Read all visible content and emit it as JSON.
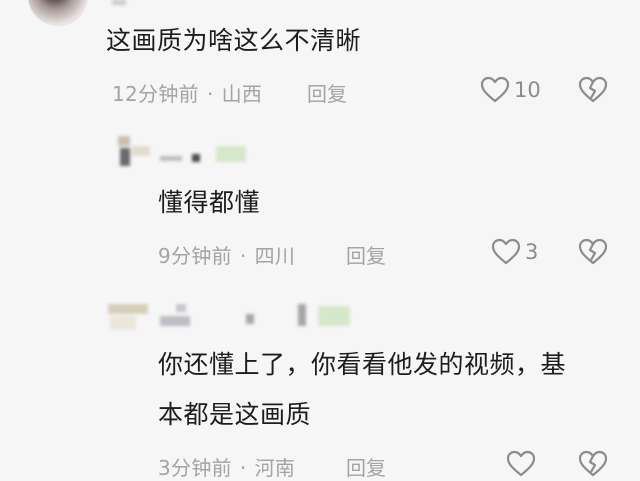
{
  "comments": [
    {
      "text": "这画质为啥这么不清晰",
      "time": "12分钟前",
      "location": "山西",
      "reply_label": "回复",
      "likes": "10"
    },
    {
      "text": "懂得都懂",
      "time": "9分钟前",
      "location": "四川",
      "reply_label": "回复",
      "likes": "3"
    },
    {
      "text_line1": "你还懂上了，你看看他发的视频，基",
      "text_line2": "本都是这画质",
      "time": "3分钟前",
      "location": "河南",
      "reply_label": "回复"
    }
  ],
  "meta_separator": "·",
  "colors": {
    "background": "#f6f6f7",
    "text": "#1d1d1d",
    "meta": "#a3a3a8",
    "icon": "#8b8b90"
  }
}
